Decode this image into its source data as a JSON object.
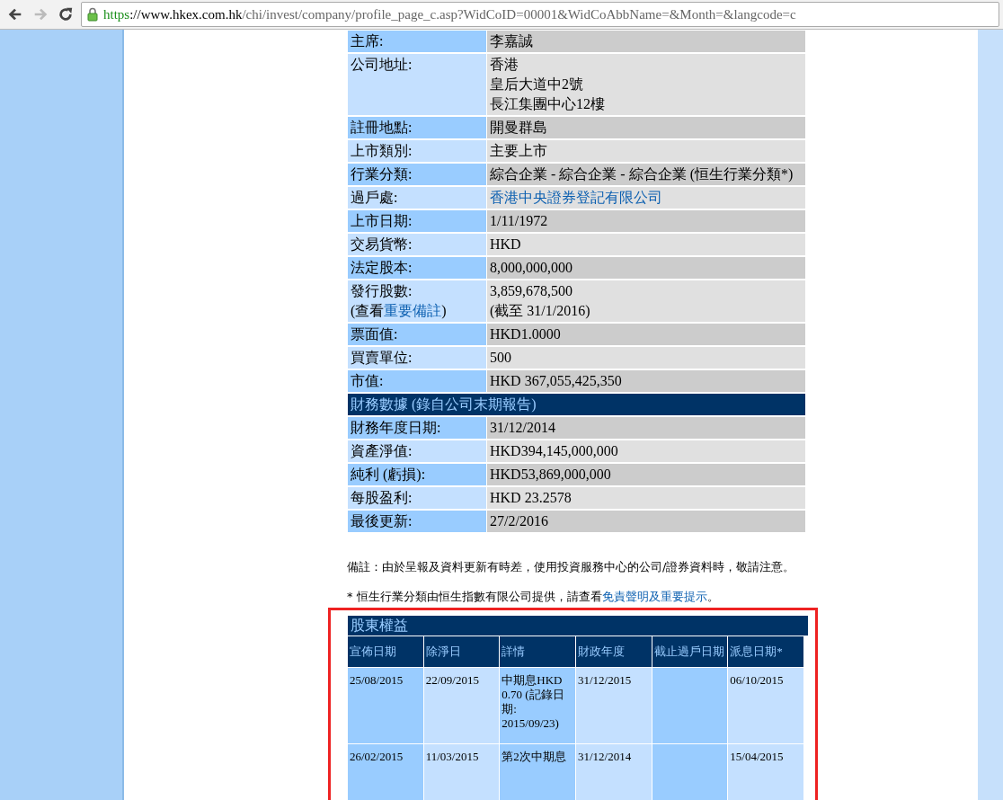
{
  "browser": {
    "back": {
      "disabled": false
    },
    "forward": {
      "disabled": true
    },
    "url": {
      "scheme": "https",
      "separator": "://",
      "host": "www.hkex.com.hk",
      "path": "/chi/invest/company/profile_page_c.asp?WidCoID=00001&WidCoAbbName=&Month=&langcode=c"
    }
  },
  "profile": [
    {
      "kind": "field",
      "label": "主席:",
      "value_lines": [
        "李嘉誠"
      ]
    },
    {
      "kind": "field",
      "label": "公司地址:",
      "value_lines": [
        "香港",
        "皇后大道中2號",
        "長江集團中心12樓"
      ]
    },
    {
      "kind": "field",
      "label": "註冊地點:",
      "value_lines": [
        "開曼群島"
      ]
    },
    {
      "kind": "field",
      "label": "上市類別:",
      "value_lines": [
        "主要上市"
      ]
    },
    {
      "kind": "field",
      "label": "行業分類:",
      "value_lines": [
        "綜合企業 - 綜合企業 - 綜合企業 (恒生行業分類*)"
      ]
    },
    {
      "kind": "link",
      "label": "過戶處:",
      "value_lines": [
        "香港中央證券登記有限公司"
      ]
    },
    {
      "kind": "field",
      "label": "上市日期:",
      "value_lines": [
        "1/11/1972"
      ]
    },
    {
      "kind": "field",
      "label": "交易貨幣:",
      "value_lines": [
        "HKD"
      ]
    },
    {
      "kind": "field",
      "label": "法定股本:",
      "value_lines": [
        "8,000,000,000"
      ]
    },
    {
      "kind": "field",
      "label": "發行股數:",
      "label_note": {
        "before": "(查看",
        "link": "重要備註",
        "after": ")"
      },
      "value_lines": [
        "3,859,678,500",
        "(截至 31/1/2016)"
      ]
    },
    {
      "kind": "field",
      "label": "票面值:",
      "value_lines": [
        "HKD1.0000"
      ]
    },
    {
      "kind": "field",
      "label": "買賣單位:",
      "value_lines": [
        "500"
      ]
    },
    {
      "kind": "field",
      "label": "市值:",
      "value_lines": [
        "HKD 367,055,425,350"
      ]
    },
    {
      "kind": "section",
      "label": "財務數據 (錄自公司末期報告)"
    },
    {
      "kind": "field",
      "label": "財務年度日期:",
      "value_lines": [
        "31/12/2014"
      ]
    },
    {
      "kind": "field",
      "label": "資產淨值:",
      "value_lines": [
        "HKD394,145,000,000"
      ]
    },
    {
      "kind": "field",
      "label": "純利 (虧損):",
      "value_lines": [
        "HKD53,869,000,000"
      ]
    },
    {
      "kind": "field",
      "label": "每股盈利:",
      "value_lines": [
        "HKD 23.2578"
      ]
    },
    {
      "kind": "field",
      "label": "最後更新:",
      "value_lines": [
        "27/2/2016"
      ]
    }
  ],
  "notes": {
    "remark": "備註：由於呈報及資料更新有時差，使用投資服務中心的公司/證券資料時，敬請注意。",
    "source": {
      "before": "* 恒生行業分類由恒生指數有限公司提供，請查看",
      "link": "免責聲明及重要提示",
      "after": "。"
    }
  },
  "dividends": {
    "title": "股東權益",
    "columns": [
      "宣佈日期",
      "除淨日",
      "詳情",
      "財政年度",
      "截止過戶日期",
      "派息日期*"
    ],
    "rows": [
      [
        "25/08/2015",
        "22/09/2015",
        "中期息HKD 0.70 (記錄日期: 2015/09/23)",
        "31/12/2015",
        "",
        "06/10/2015"
      ],
      [
        "26/02/2015",
        "11/03/2015",
        "第2次中期息",
        "31/12/2014",
        "",
        "15/04/2015"
      ]
    ]
  }
}
